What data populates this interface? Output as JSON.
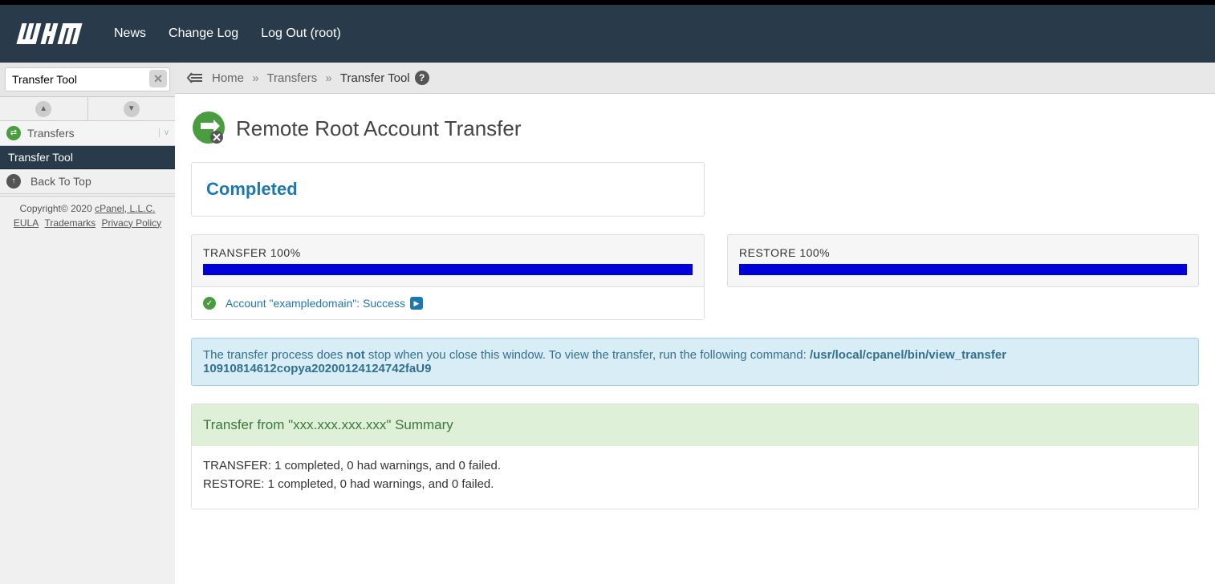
{
  "topnav": {
    "news": "News",
    "changelog": "Change Log",
    "logout": "Log Out (root)"
  },
  "sidebar": {
    "search_value": "Transfer Tool",
    "section_label": "Transfers",
    "item_transfer_tool": "Transfer Tool",
    "back_to_top": "Back To Top",
    "copyright": "Copyright© 2020 ",
    "copyright_link": "cPanel, L.L.C.",
    "eula": "EULA",
    "trademarks": "Trademarks",
    "privacy": "Privacy Policy"
  },
  "breadcrumb": {
    "home": "Home",
    "transfers": "Transfers",
    "current": "Transfer Tool"
  },
  "page": {
    "title": "Remote Root Account Transfer",
    "status": "Completed"
  },
  "transfer": {
    "label": "TRANSFER  100%",
    "result_text": "Account \"exampledomain\": Success"
  },
  "restore": {
    "label": "RESTORE  100%"
  },
  "alert": {
    "pre": "The transfer process does ",
    "not": "not",
    "mid": " stop when you close this window. To view the transfer, run the following command: ",
    "cmd": "/usr/local/cpanel/bin/view_transfer 10910814612copya20200124124742faU9"
  },
  "summary": {
    "title": "Transfer from \"xxx.xxx.xxx.xxx\" Summary",
    "line1": "TRANSFER: 1 completed, 0 had warnings, and 0 failed.",
    "line2": "RESTORE: 1 completed, 0 had warnings, and 0 failed."
  }
}
